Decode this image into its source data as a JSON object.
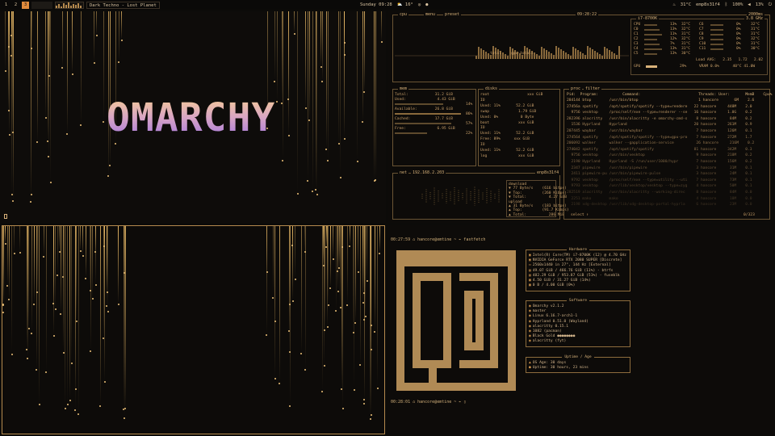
{
  "topbar": {
    "workspaces": [
      "1",
      "2",
      "3"
    ],
    "active_workspace": "3",
    "media": "Dark Techno - Lost Planet",
    "clock": "Sunday 09:28",
    "weather": "⛅ 16°",
    "right": {
      "temp": "31°C",
      "host": "emp8s31f4",
      "battery": "100%",
      "volume": "13%"
    }
  },
  "logo_text": "OMARCHY",
  "btop": {
    "cpu_title": "cpu",
    "cpu_menu": "menu",
    "preset": "preset",
    "clock": "09:28:22",
    "ms": "2000ms",
    "graph_label": "total",
    "graph_label2": "gpu-totals",
    "cpu_model": "i7-8700K",
    "freq": "3.8 GHz",
    "cores_left": [
      {
        "label": "CPU",
        "pct": "13%",
        "temp": "32°C"
      },
      {
        "label": "C0",
        "pct": "13%",
        "temp": "32°C"
      },
      {
        "label": "C1",
        "pct": "11%",
        "temp": "31°C"
      },
      {
        "label": "C2",
        "pct": "12%",
        "temp": "32°C"
      },
      {
        "label": "C3",
        "pct": "7%",
        "temp": "31°C"
      },
      {
        "label": "C4",
        "pct": "13%",
        "temp": "31°C"
      },
      {
        "label": "C5",
        "pct": "13%",
        "temp": "30°C"
      }
    ],
    "cores_right": [
      {
        "label": "C6",
        "pct": "0%",
        "temp": "32°C"
      },
      {
        "label": "C7",
        "pct": "0%",
        "temp": "31°C"
      },
      {
        "label": "C8",
        "pct": "0%",
        "temp": "31°C"
      },
      {
        "label": "C9",
        "pct": "0%",
        "temp": "32°C"
      },
      {
        "label": "C10",
        "pct": "0%",
        "temp": "31°C"
      },
      {
        "label": "C11",
        "pct": "0%",
        "temp": "30°C"
      }
    ],
    "load_avg": "Load AVG:   2.35   1.72   2.02",
    "gpu_line": "GPU",
    "gpu_pct": "29%",
    "vram": "VRAM 0.0%      40°C 41.0W",
    "mem_title": "mem",
    "mem_rows": [
      "Total:            31.2 GiB",
      "Used:              4.43 GiB",
      "Available:        26.8 GiB",
      "Cached:           17.7 GiB",
      "Free:              6.95 GiB"
    ],
    "mem_pcts": [
      "14%",
      "86%",
      "57%",
      "22%"
    ],
    "disks_title": "disks",
    "disks_rows": [
      "root                 xxx GiB",
      "IO",
      "Used: 11%       52.2 GiB",
      "swap             1.79 GiB",
      "Used: 0%          0 Byte",
      "boot             xxx GiB",
      "IO",
      "Used: 11%       52.2 GiB",
      "Free: 89%      xxx GiB",
      "IO",
      "Used: 11%       52.2 GiB",
      "log              xxx GiB"
    ],
    "net_title": "net",
    "net_ip": "192.168.2.203",
    "net_iface": "enp8s31f4",
    "net_rows": [
      "download",
      "▼ 77 Byte/s    (616 bitps)",
      "▼ Top:         (260 Kibps)",
      "▼ Total:          4.27 GiB",
      "upload",
      "▲ 31 Byte/s    (183 bitps)",
      "▲ Top:         (91.7 Kibps)",
      "▲ Total:          286 MiB"
    ],
    "proc_title": "proc",
    "proc_filter": "filter",
    "proc_header": "Pid:  Program:           Command:                          Threads: User:       MemB    Cpu%",
    "procs": [
      "284144 btop        /usr/bin/btop                           1 hancore       6M    2.6",
      "27456a spotify     /opt/spotify/spotify --type=rendere   22 hancore     448M    2.0",
      "  9756 vesktop     /proc/self/exe --type=renderer --se   16 hancore     1.0G    0.2",
      "282396 alacritty   /usr/bin/alacritty -e omarchy-cmd-s    8 hancore      84M    0.2",
      "  1536 Hyprland    Hyprland                              20 hancore     261M    0.9",
      "207445 waybar      /usr/bin/waybar                        7 hancore     126M    0.1",
      "274564 spotify     /opt/spotify/spotify --type=gpu-pro    7 hancore     272M    1.7",
      "206092 walker      walker --gapplication-service          26 hancore     216M    0.2",
      "274042 spotify     /opt/spotify/spotify                  81 hancore     342M    0.3",
      "  9756 vesktop     /usr/bin/vesktop                       9 hancore     218M    0.2",
      "  2190 Hyprland    Hyprland -S /run/user/1000/hypr        7 hancore     156M    0.2",
      "  2347 pipewire    /usr/bin/pipewire                      3 hancore      31M    0.1",
      "  2411 pipewire-pu /usr/bin/pipewire-pulse                3 hancore      24M    0.1",
      "  9792 vesktop     /proc/self/exe --type=utility --uti    7 hancore      73M    0.1",
      "  9793 vesktop     /usr/lib/vesktop/vesktop --type=zyg    4 hancore      50M    0.1",
      "282519 alacritty   /usr/bin/alacritty --working-direc     8 hancore      84M    0.0",
      "  2251 mako        mako                                   4 hancore      18M    0.0",
      "  2198 xdg-desktop /usr/lib/xdg-desktop-portal-hyprla     6 hancore      23M    0.0"
    ],
    "proc_footer": "select ↑",
    "proc_count": "0/323"
  },
  "fetch": {
    "prompt1": "00:27:59 ⌂ hancore@emtine ~ ⌁ fastfetch",
    "prompt2": "00:28:01 ⌂ hancore@emtine ~ ⌁ ▯",
    "hardware_title": "Hardware",
    "hardware": [
      {
        "icon": "▣",
        "text": "Intel(R) Core(TM) i7-8700K (12) @ 4.70 GHz"
      },
      {
        "icon": "▣",
        "text": "NVIDIA GeForce RTX 2080 SUPER [Discrete]"
      },
      {
        "icon": "▭",
        "text": "2560x1440 in 27\", 144 Hz [External]"
      },
      {
        "icon": "▤",
        "text": "49.07 GiB / 466.76 GiB (11%) - btrfs"
      },
      {
        "icon": "▤",
        "text": "482.29 GiB / 953.87 GiB (51%) - fuseblk"
      },
      {
        "icon": "▦",
        "text": "4.50 GiB / 31.27 GiB (14%)"
      },
      {
        "icon": "▦",
        "text": "0 B / 4.00 GiB (0%)"
      }
    ],
    "software_title": "Software",
    "software": [
      {
        "icon": "◉",
        "text": "Omarchy v2.1.2"
      },
      {
        "icon": "◉",
        "text": "master"
      },
      {
        "icon": "◉",
        "text": "Linux 6.16.7-arch1-1"
      },
      {
        "icon": "◉",
        "text": "Hyprland 0.51.0 (Wayland)"
      },
      {
        "icon": "◉",
        "text": "alacritty 0.15.1"
      },
      {
        "icon": "◉",
        "text": "1082 (pacman)"
      },
      {
        "icon": "◉",
        "text": "Black Gold ●●●●●●●●"
      },
      {
        "icon": "◉",
        "text": "alacritty (fyt)"
      }
    ],
    "uptime_title": "Uptime / Age",
    "uptime": [
      {
        "icon": "▲",
        "text": "OS Age: 30 days"
      },
      {
        "icon": "●",
        "text": "Uptime: 30 hours, 23 mins"
      }
    ]
  }
}
